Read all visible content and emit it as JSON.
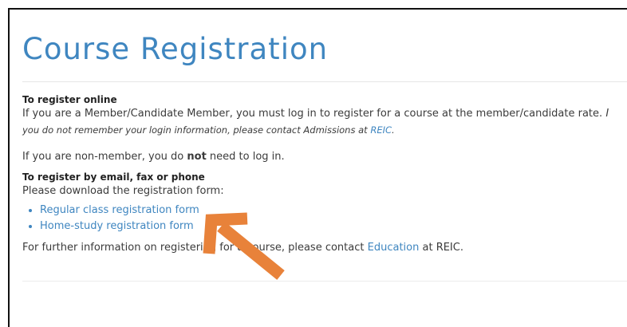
{
  "page": {
    "title": "Course Registration"
  },
  "online": {
    "heading": "To register online",
    "line1": "If you are a Member/Candidate Member, you must log in to register for a course at the member/candidate rate.",
    "line1_trail": "I",
    "line2_prefix": "you do not remember your login information, please contact Admissions at ",
    "line2_link": "REIC",
    "line2_suffix": ".",
    "nonmember_prefix": "If you are non-member, you do ",
    "nonmember_bold": "not",
    "nonmember_suffix": " need to log in."
  },
  "offline": {
    "heading": "To register by email, fax or phone",
    "intro": "Please download the registration form:",
    "links": [
      "Regular class registration form",
      "Home-study registration form"
    ],
    "further_prefix": "For further information on registering for a course, please contact ",
    "further_link": "Education",
    "further_suffix": " at REIC."
  },
  "annotation": {
    "arrow_color": "#e8823a",
    "arrow_target": "Regular class registration form"
  }
}
